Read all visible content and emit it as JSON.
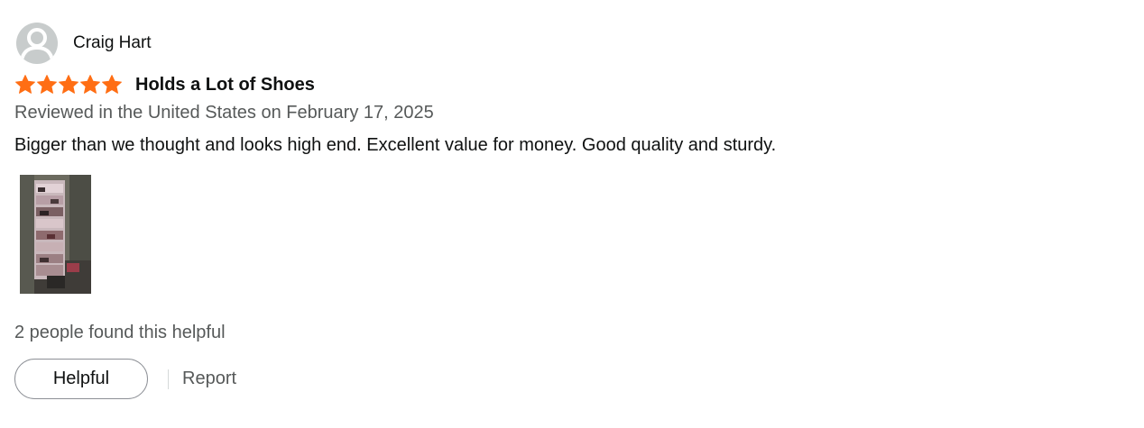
{
  "review": {
    "author": "Craig Hart",
    "avatar_icon": "user-silhouette-icon",
    "rating": 5,
    "rating_max": 5,
    "star_color": "#ff6e14",
    "star_icon": "star-icon",
    "title": "Holds a Lot of Shoes",
    "date": "Reviewed in the United States on February 17, 2025",
    "body": "Bigger than we thought and looks high end. Excellent value for money. Good quality and sturdy.",
    "helpful_count_text": "2 people found this helpful",
    "helpful_button_label": "Helpful",
    "report_label": "Report"
  }
}
